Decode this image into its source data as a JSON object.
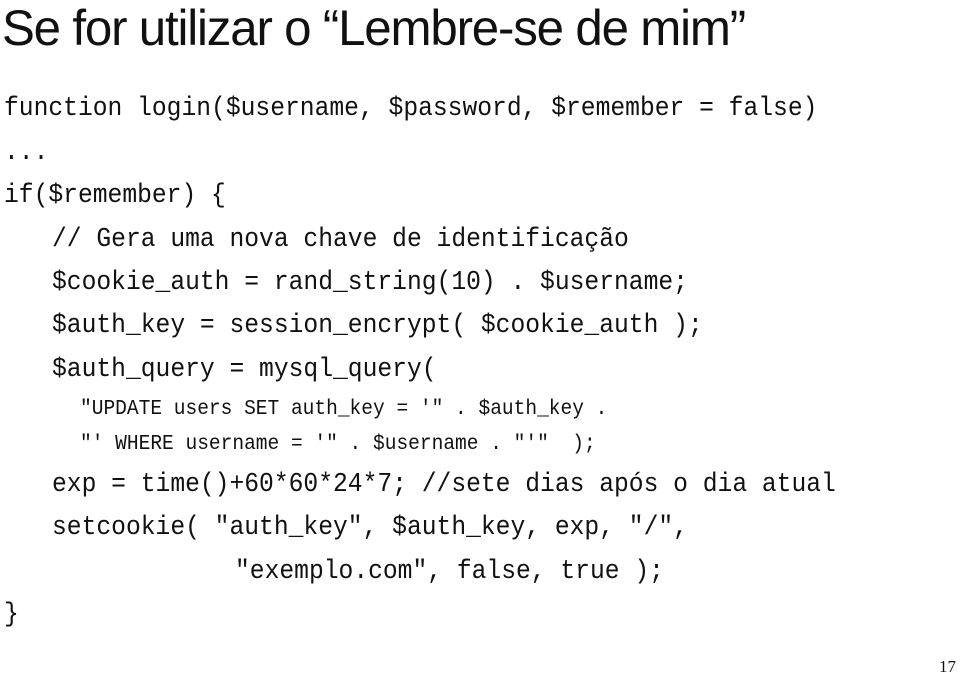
{
  "slide": {
    "title": "Se for utilizar o “Lembre-se de mim”",
    "page_number": "17",
    "code_lines": [
      "function login($username, $password, $remember = false)",
      "...",
      "if($remember) {",
      "// Gera uma nova chave de identificação",
      "$cookie_auth = rand_string(10) . $username;",
      "$auth_key = session_encrypt( $cookie_auth );",
      "$auth_query = mysql_query(",
      "\"UPDATE users SET auth_key = '\" . $auth_key .",
      "\"' WHERE username = '\" . $username . \"'\"  );",
      "exp = time()+60*60*24*7; //sete dias após o dia atual",
      "setcookie( \"auth_key\", $auth_key, exp, \"/\",",
      "\"exemplo.com\", false, true );",
      "}"
    ]
  }
}
